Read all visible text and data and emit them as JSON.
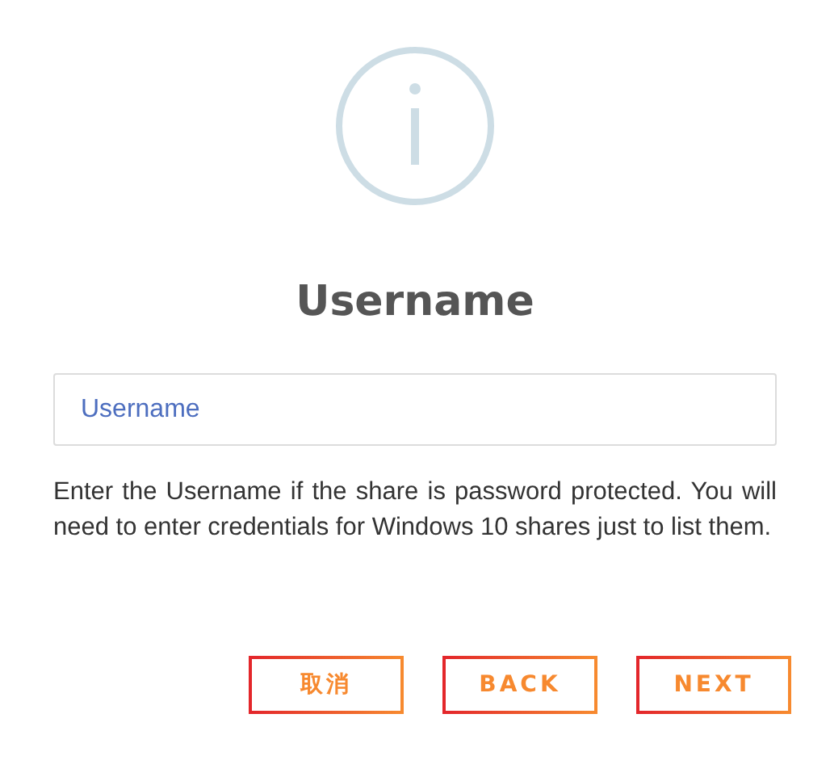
{
  "title": "Username",
  "field": {
    "placeholder": "Username"
  },
  "help": "Enter the Username if the share is password protected. You will need to enter credentials for Windows 10 shares just to list them.",
  "buttons": [
    "取消",
    "BACK",
    "NEXT"
  ]
}
